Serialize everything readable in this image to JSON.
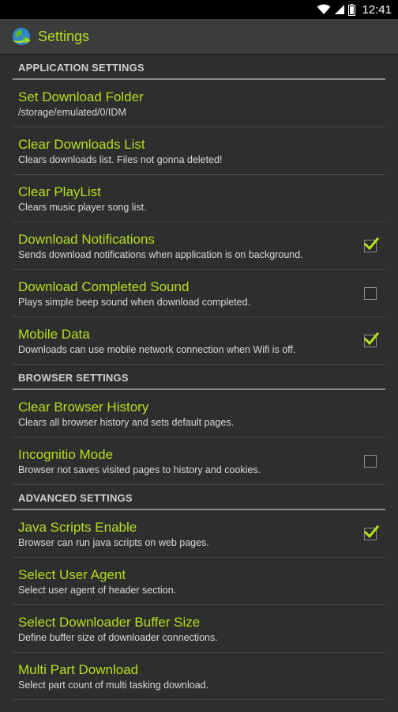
{
  "status_bar": {
    "time": "12:41",
    "icons": [
      "wifi-icon",
      "signal-icon",
      "battery-icon"
    ]
  },
  "action_bar": {
    "title": "Settings",
    "logo": "idm-logo-icon"
  },
  "colors": {
    "accent": "#b4e01e",
    "background": "#2e2e2e",
    "action_bar": "#3c3c3c"
  },
  "sections": [
    {
      "header": "APPLICATION SETTINGS",
      "items": [
        {
          "title": "Set Download Folder",
          "subtitle": "/storage/emulated/0/IDM",
          "checkbox": null
        },
        {
          "title": "Clear Downloads List",
          "subtitle": "Clears downloads list. Files not gonna deleted!",
          "checkbox": null
        },
        {
          "title": "Clear PlayList",
          "subtitle": "Clears music player song list.",
          "checkbox": null
        },
        {
          "title": "Download Notifications",
          "subtitle": "Sends download notifications when application is on background.",
          "checkbox": true
        },
        {
          "title": "Download Completed Sound",
          "subtitle": "Plays simple beep sound when download completed.",
          "checkbox": false
        },
        {
          "title": "Mobile Data",
          "subtitle": "Downloads can use mobile network connection when Wifi is off.",
          "checkbox": true
        }
      ]
    },
    {
      "header": "BROWSER SETTINGS",
      "items": [
        {
          "title": "Clear Browser History",
          "subtitle": "Clears all browser history and sets default pages.",
          "checkbox": null
        },
        {
          "title": "Incognitio Mode",
          "subtitle": "Browser not saves visited pages to history and cookies.",
          "checkbox": false
        }
      ]
    },
    {
      "header": "ADVANCED SETTINGS",
      "items": [
        {
          "title": "Java Scripts Enable",
          "subtitle": "Browser can run java scripts on web pages.",
          "checkbox": true
        },
        {
          "title": "Select User Agent",
          "subtitle": "Select user agent of header section.",
          "checkbox": null
        },
        {
          "title": "Select Downloader Buffer Size",
          "subtitle": "Define buffer size of downloader connections.",
          "checkbox": null
        },
        {
          "title": "Multi Part Download",
          "subtitle": "Select part count of multi tasking download.",
          "checkbox": null
        }
      ]
    }
  ]
}
